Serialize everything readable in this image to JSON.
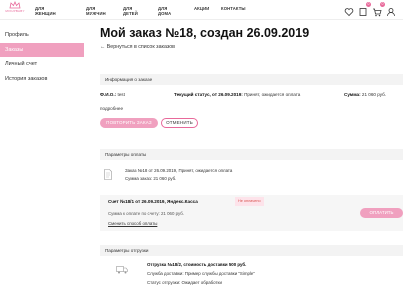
{
  "header": {
    "logo_text": "MIXUPBABY",
    "nav": [
      "Для женщин",
      "Для мужчин",
      "Для детей",
      "Для дома",
      "Акции",
      "Контакты"
    ],
    "wishlist_count": "",
    "compare_count": "0",
    "cart_count": "0",
    "colors": {
      "accent": "#e8699a",
      "accent_light": "#f0a0bf"
    }
  },
  "sidebar": {
    "items": [
      {
        "label": "Профиль"
      },
      {
        "label": "Заказы"
      },
      {
        "label": "Личный счет"
      },
      {
        "label": "История заказов"
      }
    ],
    "active_index": 1
  },
  "main": {
    "title": "Мой заказ №18, создан 26.09.2019",
    "back_link": "← Вернуться в список заказов",
    "order_info": {
      "heading": "Информация о заказе",
      "fio_label": "Ф.И.О.:",
      "fio_value": "test",
      "status_label": "Текущий статус, от 26.09.2019:",
      "status_value": "Принят, ожидается оплата",
      "sum_label": "Сумма:",
      "sum_value": "21 060 руб.",
      "details_link": "подробнее",
      "repeat_button": "Повторить заказ",
      "cancel_button": "Отменить"
    },
    "payment": {
      "heading": "Параметры оплаты",
      "line1": "Заказ №18 от 26.09.2019, Принят, ожидается оплата",
      "line2": "Сумма заказ: 21 060 руб.",
      "invoice_title": "Счет №18/1 от 26.09.2019, Яндекс.Касса",
      "unpaid_badge": "Не оплачено",
      "invoice_sum": "Сумма к оплате по счету: 21 060 руб.",
      "change_link": "Сменить способ оплаты",
      "pay_button": "Оплатить"
    },
    "shipping": {
      "heading": "Параметры отгрузки",
      "title": "Отгрузка №18/2, стоимость доставки 500 руб.",
      "service": "Служба доставки: Пример службы доставки \"Simple\"",
      "status": "Статус отгрузки: Ожидает обработки"
    }
  }
}
